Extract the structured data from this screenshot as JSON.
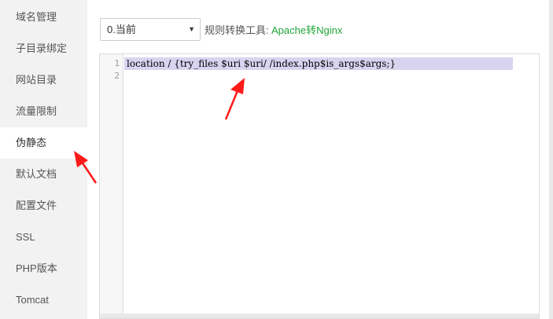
{
  "sidebar": {
    "items": [
      {
        "label": "域名管理"
      },
      {
        "label": "子目录绑定"
      },
      {
        "label": "网站目录"
      },
      {
        "label": "流量限制"
      },
      {
        "label": "伪静态",
        "active": true
      },
      {
        "label": "默认文档"
      },
      {
        "label": "配置文件"
      },
      {
        "label": "SSL"
      },
      {
        "label": "PHP版本"
      },
      {
        "label": "Tomcat"
      }
    ]
  },
  "toolbar": {
    "select_value": "0.当前",
    "tool_label": "规则转换工具:",
    "tool_link": "Apache转Nginx"
  },
  "editor": {
    "lines": [
      {
        "no": "1",
        "text": "location / {try_files $uri $uri/ /index.php$is_args$args;}"
      },
      {
        "no": "2",
        "text": ""
      }
    ]
  },
  "colors": {
    "accent_link": "#20a53a",
    "arrow": "#ff1a1a",
    "line_highlight": "#d8d4f0",
    "sidebar_bg": "#f2f2f2"
  }
}
